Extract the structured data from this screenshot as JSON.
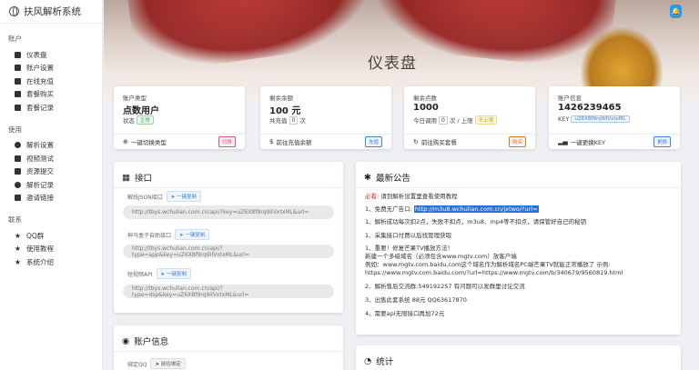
{
  "app": {
    "title": "扶风解析系统"
  },
  "sidebar": {
    "sections": [
      {
        "label": "账户",
        "items": [
          {
            "label": "仪表盘",
            "icon": "dashboard-icon"
          },
          {
            "label": "账户设置",
            "icon": "user-settings-icon"
          },
          {
            "label": "在线充值",
            "icon": "recharge-icon"
          },
          {
            "label": "套餐购买",
            "icon": "cart-icon"
          },
          {
            "label": "套餐记录",
            "icon": "plan-record-icon"
          }
        ]
      },
      {
        "label": "使用",
        "items": [
          {
            "label": "解析设置",
            "icon": "gear-icon"
          },
          {
            "label": "视频测试",
            "icon": "video-icon"
          },
          {
            "label": "资源提交",
            "icon": "upload-icon"
          },
          {
            "label": "解析记录",
            "icon": "eye-icon"
          },
          {
            "label": "邀请链接",
            "icon": "tag-icon"
          }
        ]
      },
      {
        "label": "联系",
        "items": [
          {
            "label": "QQ群",
            "icon": "star-icon"
          },
          {
            "label": "使用教程",
            "icon": "star-icon"
          },
          {
            "label": "系统介绍",
            "icon": "star-icon"
          }
        ]
      }
    ]
  },
  "header": {
    "page_title": "仪表盘"
  },
  "stats": [
    {
      "label": "账户类型",
      "value": "点数用户",
      "sub_prefix": "状态",
      "sub_badge": "正常",
      "footer": "一键切换类型",
      "footer_icon": "switch-icon",
      "action": "切换"
    },
    {
      "label": "剩余余额",
      "value": "100 元",
      "sub_prefix": "共充值",
      "sub_box": "0",
      "sub_suffix": "次",
      "footer": "前往充值余额",
      "footer_icon": "dollar-icon",
      "action": "充值"
    },
    {
      "label": "剩余点数",
      "value": "1000",
      "sub_prefix": "今日调用",
      "sub_box": "0",
      "sub_mid": "次 / 上限",
      "sub_badge": "不上限",
      "footer": "前往购买套餐",
      "footer_icon": "refresh-icon",
      "action": "购买"
    },
    {
      "label": "账户信息",
      "value": "1426239465",
      "sub_prefix": "KEY",
      "sub_badge": "uZ6XBf9rq9iIVxtxML",
      "footer": "一键更换KEY",
      "footer_icon": "signal-icon",
      "action": "更换"
    }
  ],
  "api": {
    "title": "接口",
    "copy_label": "一键复制",
    "endpoints": [
      {
        "label": "解线JSON接口",
        "url": "http://tbys.wchulian.com.cn/api/?key=uZ6XBf9rq9iIVxtxML&url="
      },
      {
        "label": "神马盒子自助接口",
        "url": "http://tbys.wchulian.com.cn/api/?type=app&key=uZ6XBf9rq9iIVxtxML&url="
      },
      {
        "label": "短视频API",
        "url": "http://tbys.wchulian.com.cn/api/?type=dsp&key=uZ6XBf9rq9iIVxtxML&url="
      }
    ]
  },
  "notice": {
    "title": "最新公告",
    "must_read_label": "必看:",
    "must_read_text": "请到解析设置里查看使用教程",
    "lines": [
      {
        "prefix": "1、免费无广告口:",
        "highlight": "http://m3u8.wchulian.com.cn/jxtwo/?url="
      },
      {
        "text": "1、解析成功每次扣2点，失败不扣点，m3u8、mp4等不扣点，请保管好自己的秘钥"
      },
      {
        "text": "1、采集接口付费以后找管理获取"
      },
      {
        "text": "1、重要！修复芒果TV播放方法！"
      },
      {
        "text": "新建一个多级域名（必须包含www.mgtv.com）放客户端"
      },
      {
        "text": "例如：www.mgtv.com.baidu.com这个域名作为解析域名PC端芒果TV就能正常播放了 示例:"
      },
      {
        "text": "https://www.mgtv.com.baidu.com/?url=https://www.mgtv.com/b/340679/9560819.html"
      },
      {
        "text": "2、解析售后交流群:549192257 有问题可以发群里讨论交流"
      },
      {
        "text": "3、出售此套系统 88元 QQ63617870"
      },
      {
        "text": "4、需要api无限接口再加72元"
      }
    ]
  },
  "account": {
    "title": "账户信息",
    "bind_qq_label": "绑定QQ",
    "bind_btn": "前往绑定"
  },
  "stats_panel": {
    "title": "统计"
  }
}
